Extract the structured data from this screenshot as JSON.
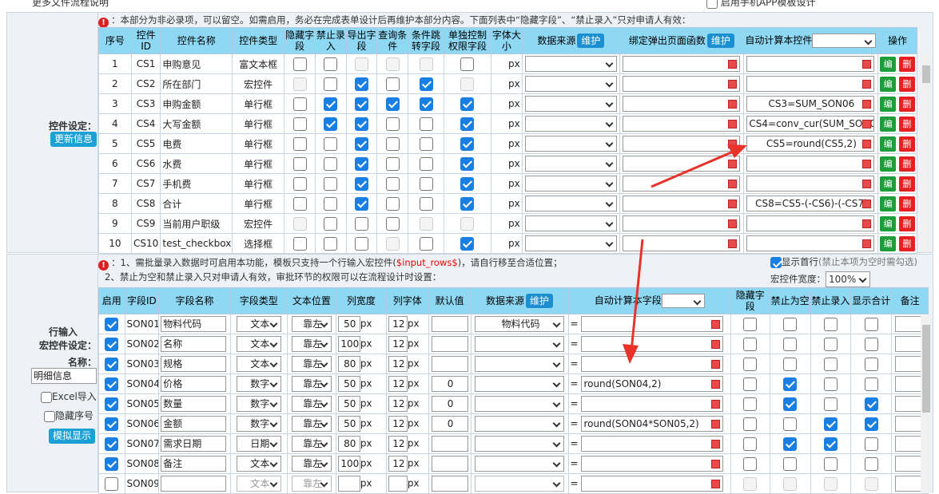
{
  "topbar": {
    "link": "更多文件流程说明",
    "mobile_cb": "启用手机APP模板设计"
  },
  "sec1": {
    "label": "控件设定：",
    "update_btn": "更新信息",
    "notice": "：本部分为非必录项，可以留空。如需启用，务必在完成表单设计后再维护本部分内容。下面列表中“隐藏字段”、“禁止录入”只对申请人有效：",
    "headers": [
      "序号",
      "控件ID",
      "控件名称",
      "控件类型",
      "隐藏字段",
      "禁止录入",
      "导出字段",
      "查询条件",
      "条件跳转字段",
      "单独控制权限字段",
      "字体大小",
      "数据来源",
      "绑定弹出页面函数",
      "自动计算本控件",
      "操作"
    ],
    "maintain": "维护",
    "px": "px",
    "edit": "编",
    "del": "删",
    "rows": [
      {
        "no": "1",
        "id": "CS1",
        "name": "申购意见",
        "type": "富文本框",
        "calc": ""
      },
      {
        "no": "2",
        "id": "CS2",
        "name": "所在部门",
        "type": "宏控件",
        "calc": ""
      },
      {
        "no": "3",
        "id": "CS3",
        "name": "申购金额",
        "type": "单行框",
        "calc": "CS3=SUM_SON06"
      },
      {
        "no": "4",
        "id": "CS4",
        "name": "大写金额",
        "type": "单行框",
        "calc": "CS4=conv_cur(SUM_SON06)"
      },
      {
        "no": "5",
        "id": "CS5",
        "name": "电费",
        "type": "单行框",
        "calc": "CS5=round(CS5,2)"
      },
      {
        "no": "6",
        "id": "CS6",
        "name": "水费",
        "type": "单行框",
        "calc": ""
      },
      {
        "no": "7",
        "id": "CS7",
        "name": "手机费",
        "type": "单行框",
        "calc": ""
      },
      {
        "no": "8",
        "id": "CS8",
        "name": "合计",
        "type": "单行框",
        "calc": "CS8=CS5-(-CS6)-(-CS7)"
      },
      {
        "no": "9",
        "id": "CS9",
        "name": "当前用户职级",
        "type": "宏控件",
        "calc": ""
      },
      {
        "no": "10",
        "id": "CS10",
        "name": "test_checkbox",
        "type": "选择框",
        "calc": ""
      }
    ]
  },
  "sec2": {
    "label1": "行输入",
    "label2": "宏控件设定：",
    "name_label": "名称：",
    "name_value": "明细信息",
    "excel_import": "Excel导入",
    "hide_seq": "隐藏序号",
    "simulate": "模拟显示",
    "notice1_a": "：1、需批量录入数据时可启用本功能，模板只支持一个行输入宏控件(",
    "notice1_red": "$input_rows$",
    "notice1_b": ")，请自行移至合适位置；",
    "notice2": "2、禁止为空和禁止录入只对申请人有效，审批环节的权限可以在流程设计时设置：",
    "show_first": "显示首行",
    "show_first_note": "(禁止本项为空时需勾选)",
    "width_label": "宏控件宽度：",
    "width_value": "100%",
    "headers": [
      "启用",
      "字段ID",
      "字段名称",
      "字段类型",
      "文本位置",
      "列宽度",
      "列字体",
      "默认值",
      "数据来源",
      "自动计算本字段",
      "隐藏字段",
      "禁止为空",
      "禁止录入",
      "显示合计",
      "备注"
    ],
    "maintain": "维护",
    "px": "px",
    "eq": "=",
    "rows": [
      {
        "id": "SON01",
        "name": "物料代码",
        "type": "文本",
        "pos": "靠左",
        "w": "50",
        "f": "12",
        "def": "",
        "src": "物料代码",
        "calc": ""
      },
      {
        "id": "SON02",
        "name": "名称",
        "type": "文本",
        "pos": "靠左",
        "w": "100",
        "f": "12",
        "def": "",
        "src": "",
        "calc": ""
      },
      {
        "id": "SON03",
        "name": "规格",
        "type": "文本",
        "pos": "靠左",
        "w": "80",
        "f": "12",
        "def": "",
        "src": "",
        "calc": ""
      },
      {
        "id": "SON04",
        "name": "价格",
        "type": "数字",
        "pos": "靠左",
        "w": "50",
        "f": "12",
        "def": "0",
        "src": "",
        "calc": "round(SON04,2)"
      },
      {
        "id": "SON05",
        "name": "数量",
        "type": "数字",
        "pos": "靠左",
        "w": "50",
        "f": "12",
        "def": "0",
        "src": "",
        "calc": ""
      },
      {
        "id": "SON06",
        "name": "金额",
        "type": "数字",
        "pos": "靠左",
        "w": "50",
        "f": "12",
        "def": "0",
        "src": "",
        "calc": "round(SON04*SON05,2)"
      },
      {
        "id": "SON07",
        "name": "需求日期",
        "type": "日期",
        "pos": "靠左",
        "w": "80",
        "f": "12",
        "def": "",
        "src": "",
        "calc": ""
      },
      {
        "id": "SON08",
        "name": "备注",
        "type": "文本",
        "pos": "靠左",
        "w": "100",
        "f": "12",
        "def": "",
        "src": "",
        "calc": ""
      },
      {
        "id": "SON09",
        "name": "",
        "type": "文本",
        "pos": "靠左",
        "w": "",
        "f": "",
        "def": "",
        "src": "",
        "calc": ""
      }
    ]
  },
  "colors": {
    "header": "#8ed8f4",
    "check": "#1a7fe3",
    "arrow": "#e8322a",
    "button": "#1ba1d6"
  }
}
